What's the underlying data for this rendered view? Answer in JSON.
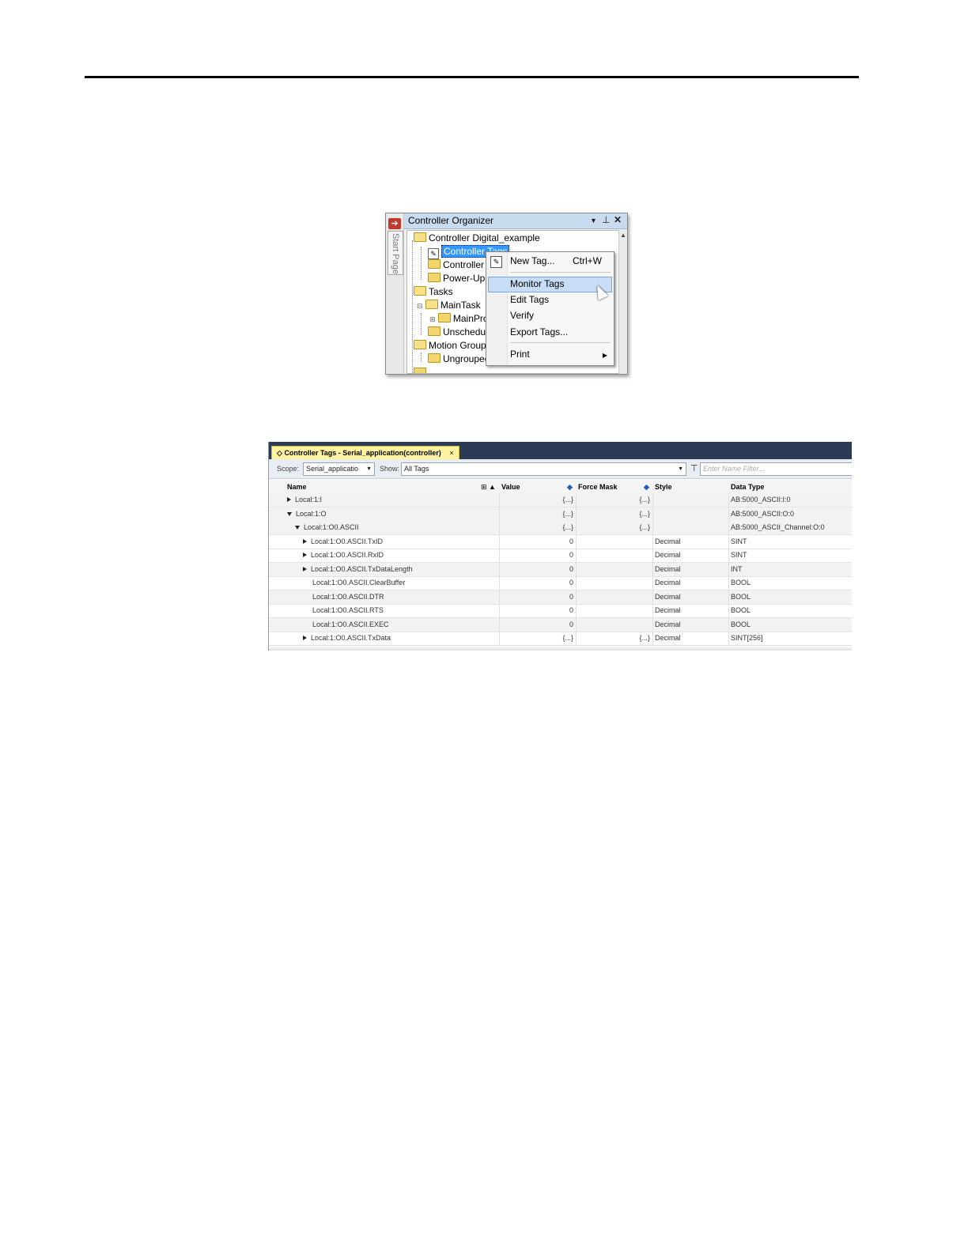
{
  "organizer": {
    "side_tab": "Start Page",
    "title": "Controller Organizer",
    "tree": [
      "Controller Digital_example",
      "Controller Tags",
      "Controller F",
      "Power-Up H",
      "Tasks",
      "MainTask",
      "MainPro",
      "Unschedule",
      "Motion Groups",
      "Ungrouped"
    ]
  },
  "context_menu": {
    "items": [
      "New Tag...",
      "Monitor Tags",
      "Edit Tags",
      "Verify",
      "Export Tags...",
      "Print"
    ],
    "shortcut": "Ctrl+W",
    "highlighted": "Monitor Tags"
  },
  "tags_window": {
    "tab_title": "Controller Tags - Serial_application(controller)",
    "tab_close": "×",
    "scope_label": "Scope:",
    "scope_value": "Serial_applicatio",
    "show_label": "Show:",
    "show_value": "All Tags",
    "filter_placeholder": "Enter Name Filter...",
    "columns": {
      "name": "Name",
      "value": "Value",
      "force_mask": "Force Mask",
      "style": "Style",
      "data_type": "Data Type"
    },
    "rows": [
      {
        "name": "Local:1:I",
        "value": "{...}",
        "force": "{...}",
        "style": "",
        "type": "AB:5000_ASCII:I:0"
      },
      {
        "name": "Local:1:O",
        "value": "{...}",
        "force": "{...}",
        "style": "",
        "type": "AB:5000_ASCII:O:0"
      },
      {
        "name": "Local:1:O0.ASCII",
        "value": "{...}",
        "force": "{...}",
        "style": "",
        "type": "AB:5000_ASCII_Channel:O:0"
      },
      {
        "name": "Local:1:O0.ASCII.TxID",
        "value": "0",
        "force": "",
        "style": "Decimal",
        "type": "SINT"
      },
      {
        "name": "Local:1:O0.ASCII.RxID",
        "value": "0",
        "force": "",
        "style": "Decimal",
        "type": "SINT"
      },
      {
        "name": "Local:1:O0.ASCII.TxDataLength",
        "value": "0",
        "force": "",
        "style": "Decimal",
        "type": "INT"
      },
      {
        "name": "Local:1:O0.ASCII.ClearBuffer",
        "value": "0",
        "force": "",
        "style": "Decimal",
        "type": "BOOL"
      },
      {
        "name": "Local:1:O0.ASCII.DTR",
        "value": "0",
        "force": "",
        "style": "Decimal",
        "type": "BOOL"
      },
      {
        "name": "Local:1:O0.ASCII.RTS",
        "value": "0",
        "force": "",
        "style": "Decimal",
        "type": "BOOL"
      },
      {
        "name": "Local:1:O0.ASCII.EXEC",
        "value": "0",
        "force": "",
        "style": "Decimal",
        "type": "BOOL"
      },
      {
        "name": "Local:1:O0.ASCII.TxData",
        "value": "{...}",
        "force": "{...}",
        "style": "Decimal",
        "type": "SINT[256]"
      }
    ]
  }
}
